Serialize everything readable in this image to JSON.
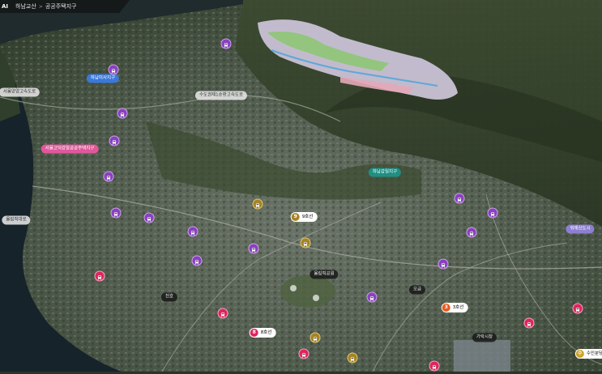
{
  "header": {
    "logo": "AI",
    "breadcrumb": [
      "하남교산",
      "공공주택지구"
    ],
    "separator": ">"
  },
  "labels": {
    "hanam_misa": "하남미사지구",
    "seoul_yangyang": "서울양양고속도로",
    "sudogwon_ring": "수도권제1순환고속도로",
    "seoul_godeok": "서울고덕강일공공주택지구",
    "hanam_gamil": "하남감일지구",
    "olympic_bridge": "올림픽대로",
    "olympic_park": "올림픽공원",
    "ogeum": "오금",
    "cheonho": "천호",
    "garak_market": "가락시장",
    "wirye": "위례신도시"
  },
  "lines": {
    "line9": {
      "num": "9",
      "text": "9호선",
      "color": "#a68324"
    },
    "line3": {
      "num": "3",
      "text": "3호선",
      "color": "#e8591d"
    },
    "line8": {
      "num": "8",
      "text": "8호선",
      "color": "#e0245e"
    },
    "suin": {
      "num": "수",
      "text": "수인분당선",
      "color": "#c9a12b"
    }
  },
  "colors": {
    "purple_station": "#8b3fc2",
    "pink_station": "#e0245e",
    "gold_station": "#a68324"
  },
  "icons": {
    "station": "train-icon"
  }
}
